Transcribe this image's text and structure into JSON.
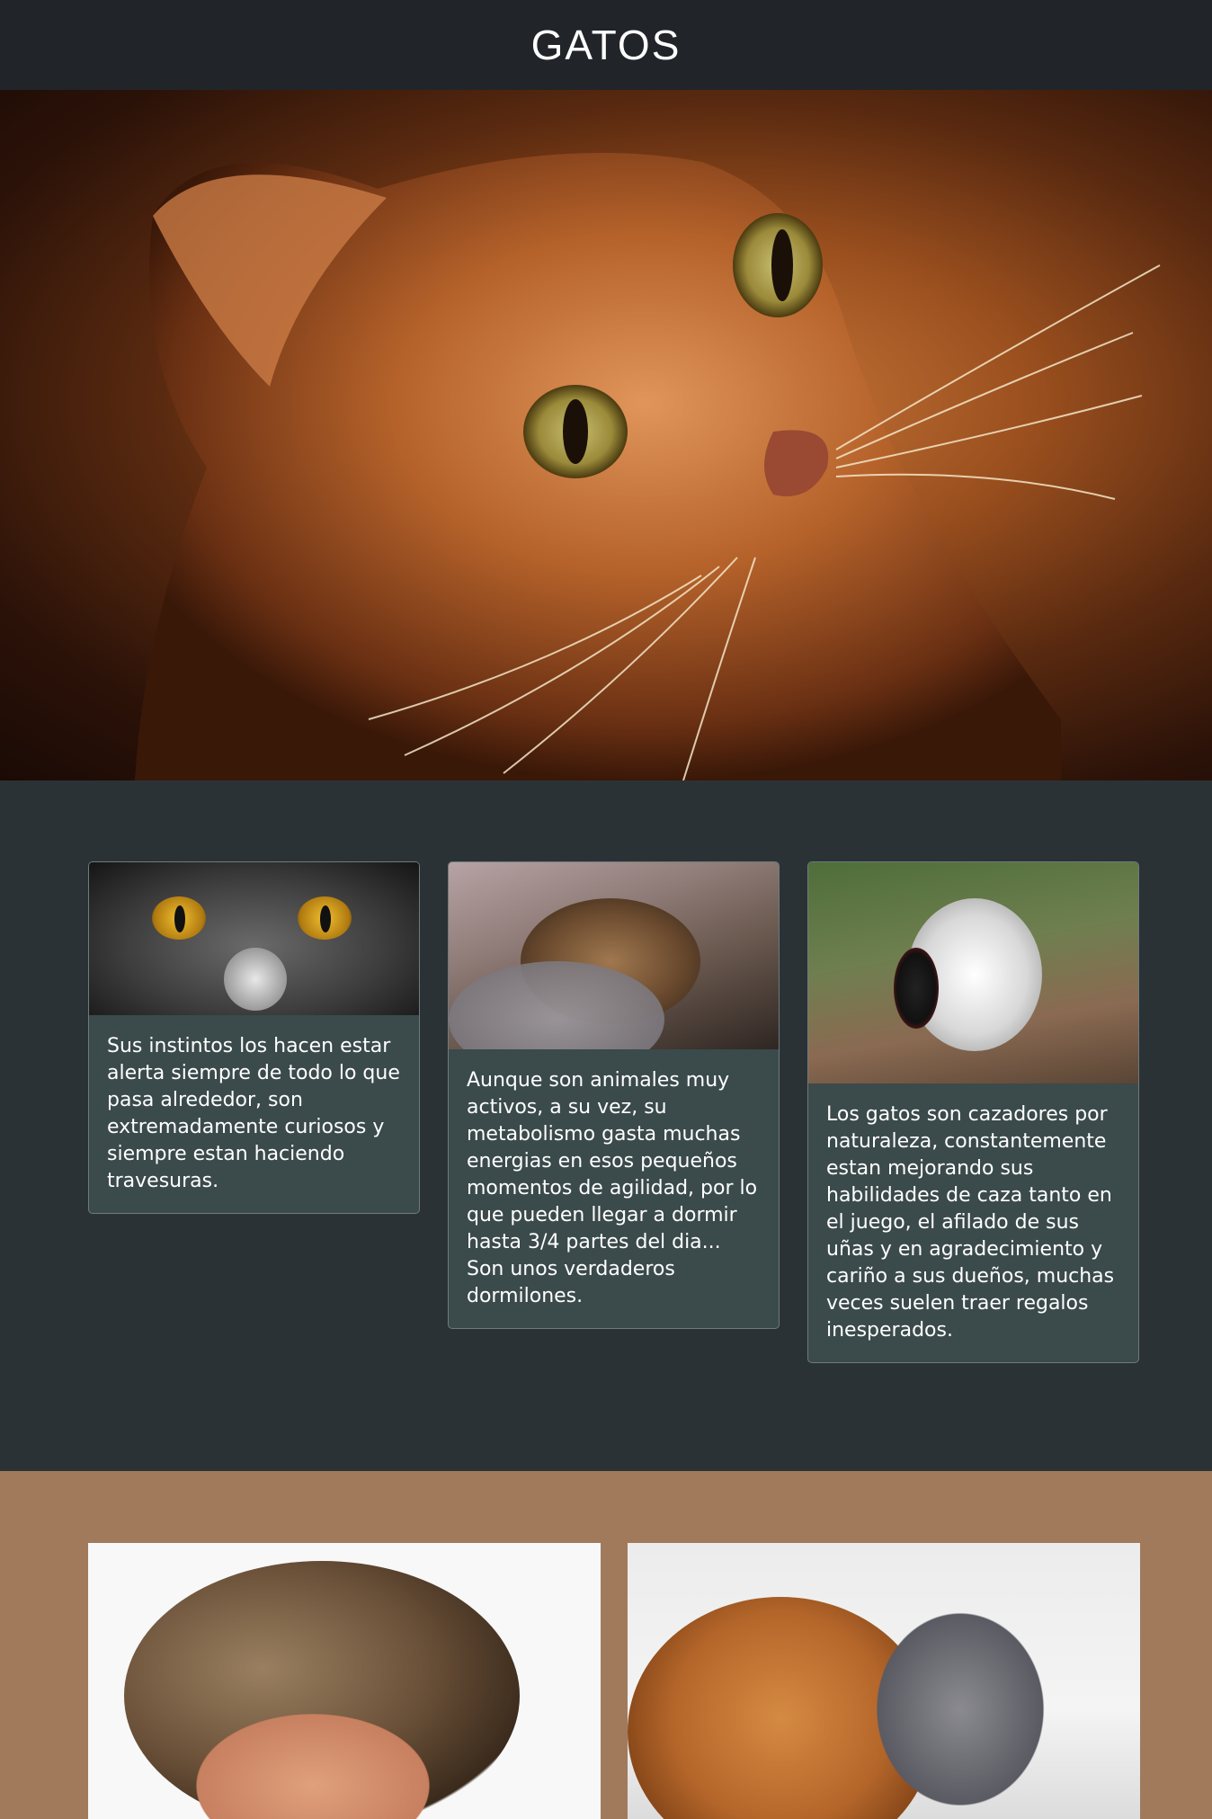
{
  "header": {
    "title": "GATOS"
  },
  "hero": {
    "image": "orange-tabby-cat-closeup"
  },
  "cards": [
    {
      "image": "gray-cat-eyes",
      "text": "Sus instintos los hacen estar alerta siempre de todo lo que pasa alrededor, son extremadamente curiosos y siempre estan haciendo travesuras."
    },
    {
      "image": "sleeping-tabby-cat",
      "text": "Aunque son animales muy activos, a su vez, su metabolismo gasta muchas energias en esos pequeños momentos de agilidad, por lo que pueden llegar a dormir hasta 3/4 partes del dia... Son unos verdaderos dormilones."
    },
    {
      "image": "cat-hunting-bird",
      "text": "Los gatos son cazadores por naturaleza, constantemente estan mejorando sus habilidades de caza tanto en el juego, el afilado de sus uñas y en agradecimiento y cariño a sus dueños, muchas veces suelen traer regalos inesperados."
    }
  ],
  "gallery": [
    {
      "image": "kitten-in-hand"
    },
    {
      "image": "dog-and-cat-lying"
    }
  ],
  "colors": {
    "header_bg": "#212529",
    "cards_section_bg": "#2b3236",
    "card_bg": "#3b4a4b",
    "bottom_section_bg": "#a17a5c"
  }
}
